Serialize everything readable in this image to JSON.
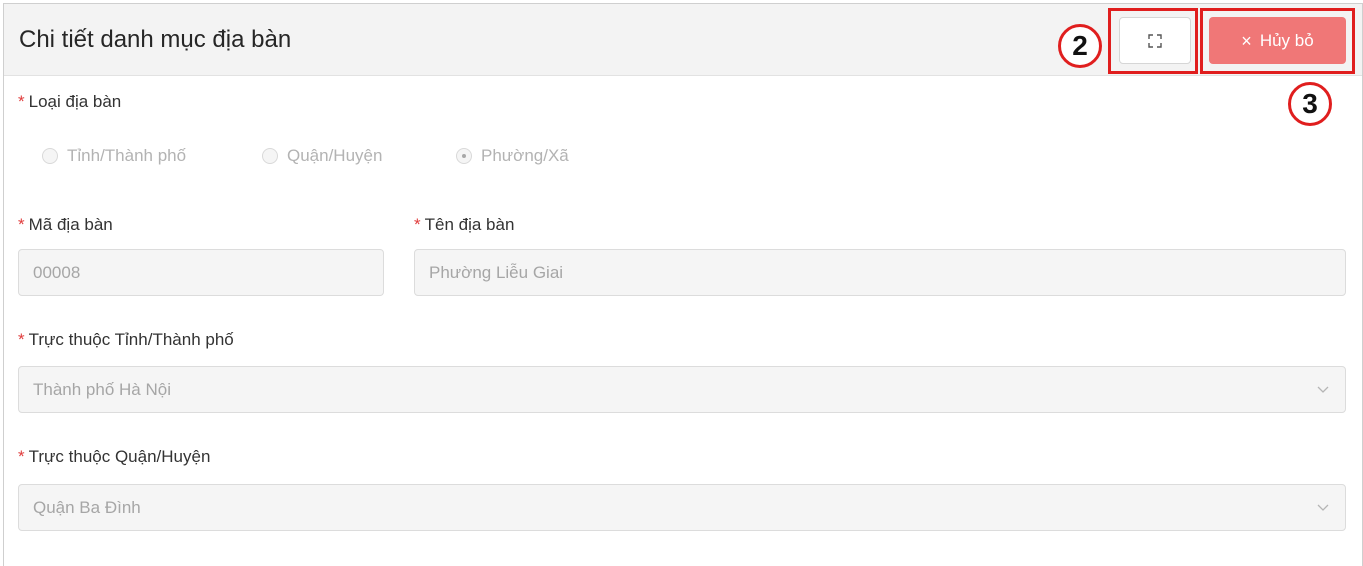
{
  "header": {
    "title": "Chi tiết danh mục địa bàn",
    "cancel_label": "Hủy bỏ",
    "annotation_fullscreen": "2",
    "annotation_cancel": "3"
  },
  "form": {
    "area_type": {
      "label": "Loại địa bàn",
      "options": [
        "Tỉnh/Thành phố",
        "Quận/Huyện",
        "Phường/Xã"
      ],
      "selected": "Phường/Xã"
    },
    "code": {
      "label": "Mã địa bàn",
      "value": "00008"
    },
    "name": {
      "label": "Tên địa bàn",
      "value": "Phường Liễu Giai"
    },
    "province": {
      "label": "Trực thuộc Tỉnh/Thành phố",
      "value": "Thành phố Hà Nội"
    },
    "district": {
      "label": "Trực thuộc Quận/Huyện",
      "value": "Quận Ba Đình"
    },
    "required_mark": "*"
  },
  "colors": {
    "cancel_button": "#f07777",
    "annotation": "#e01e1e",
    "required": "#e03c3c"
  },
  "icons": {
    "fullscreen": "expand-corners-icon",
    "cancel": "close-x-icon",
    "dropdown": "chevron-down-icon"
  }
}
